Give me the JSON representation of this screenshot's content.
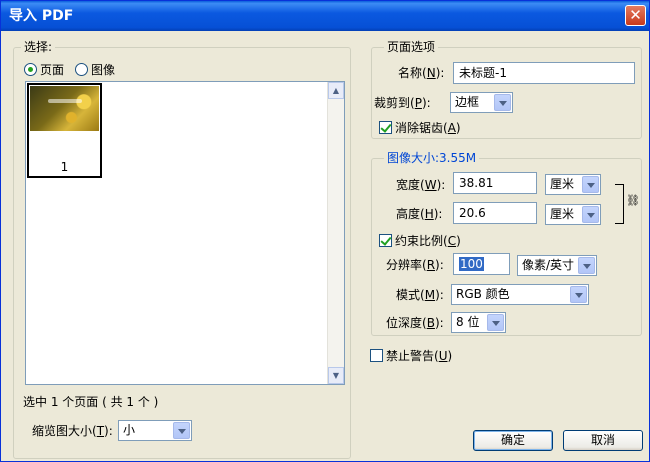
{
  "window": {
    "title": "导入 PDF",
    "close": "✕"
  },
  "left": {
    "legend": "选择:",
    "radio_pages": "页面",
    "radio_images": "图像",
    "thumb_number": "1",
    "selection_status": "选中 1 个页面 ( 共 1 个 )",
    "thumb_size_label": "缩览图大小",
    "thumb_size_key": "T",
    "thumb_size_value": "小"
  },
  "page_options": {
    "legend": "页面选项",
    "name_label": "名称",
    "name_key": "N",
    "name_value": "未标题-1",
    "crop_label": "裁剪到",
    "crop_key": "P",
    "crop_value": "边框",
    "antialias_label": "消除锯齿",
    "antialias_key": "A",
    "antialias_checked": true
  },
  "image_size": {
    "legend": "图像大小:3.55M",
    "width_label": "宽度",
    "width_key": "W",
    "width_value": "38.81",
    "width_unit": "厘米",
    "height_label": "高度",
    "height_key": "H",
    "height_value": "20.6",
    "height_unit": "厘米",
    "constrain_label": "约束比例",
    "constrain_key": "C",
    "constrain_checked": true,
    "resolution_label": "分辨率",
    "resolution_key": "R",
    "resolution_value": "100",
    "resolution_unit": "像素/英寸",
    "mode_label": "模式",
    "mode_key": "M",
    "mode_value": "RGB 颜色",
    "depth_label": "位深度",
    "depth_key": "B",
    "depth_value": "8 位"
  },
  "suppress_warnings_label": "禁止警告",
  "suppress_warnings_key": "U",
  "suppress_warnings_checked": false,
  "buttons": {
    "ok": "确定",
    "cancel": "取消"
  }
}
